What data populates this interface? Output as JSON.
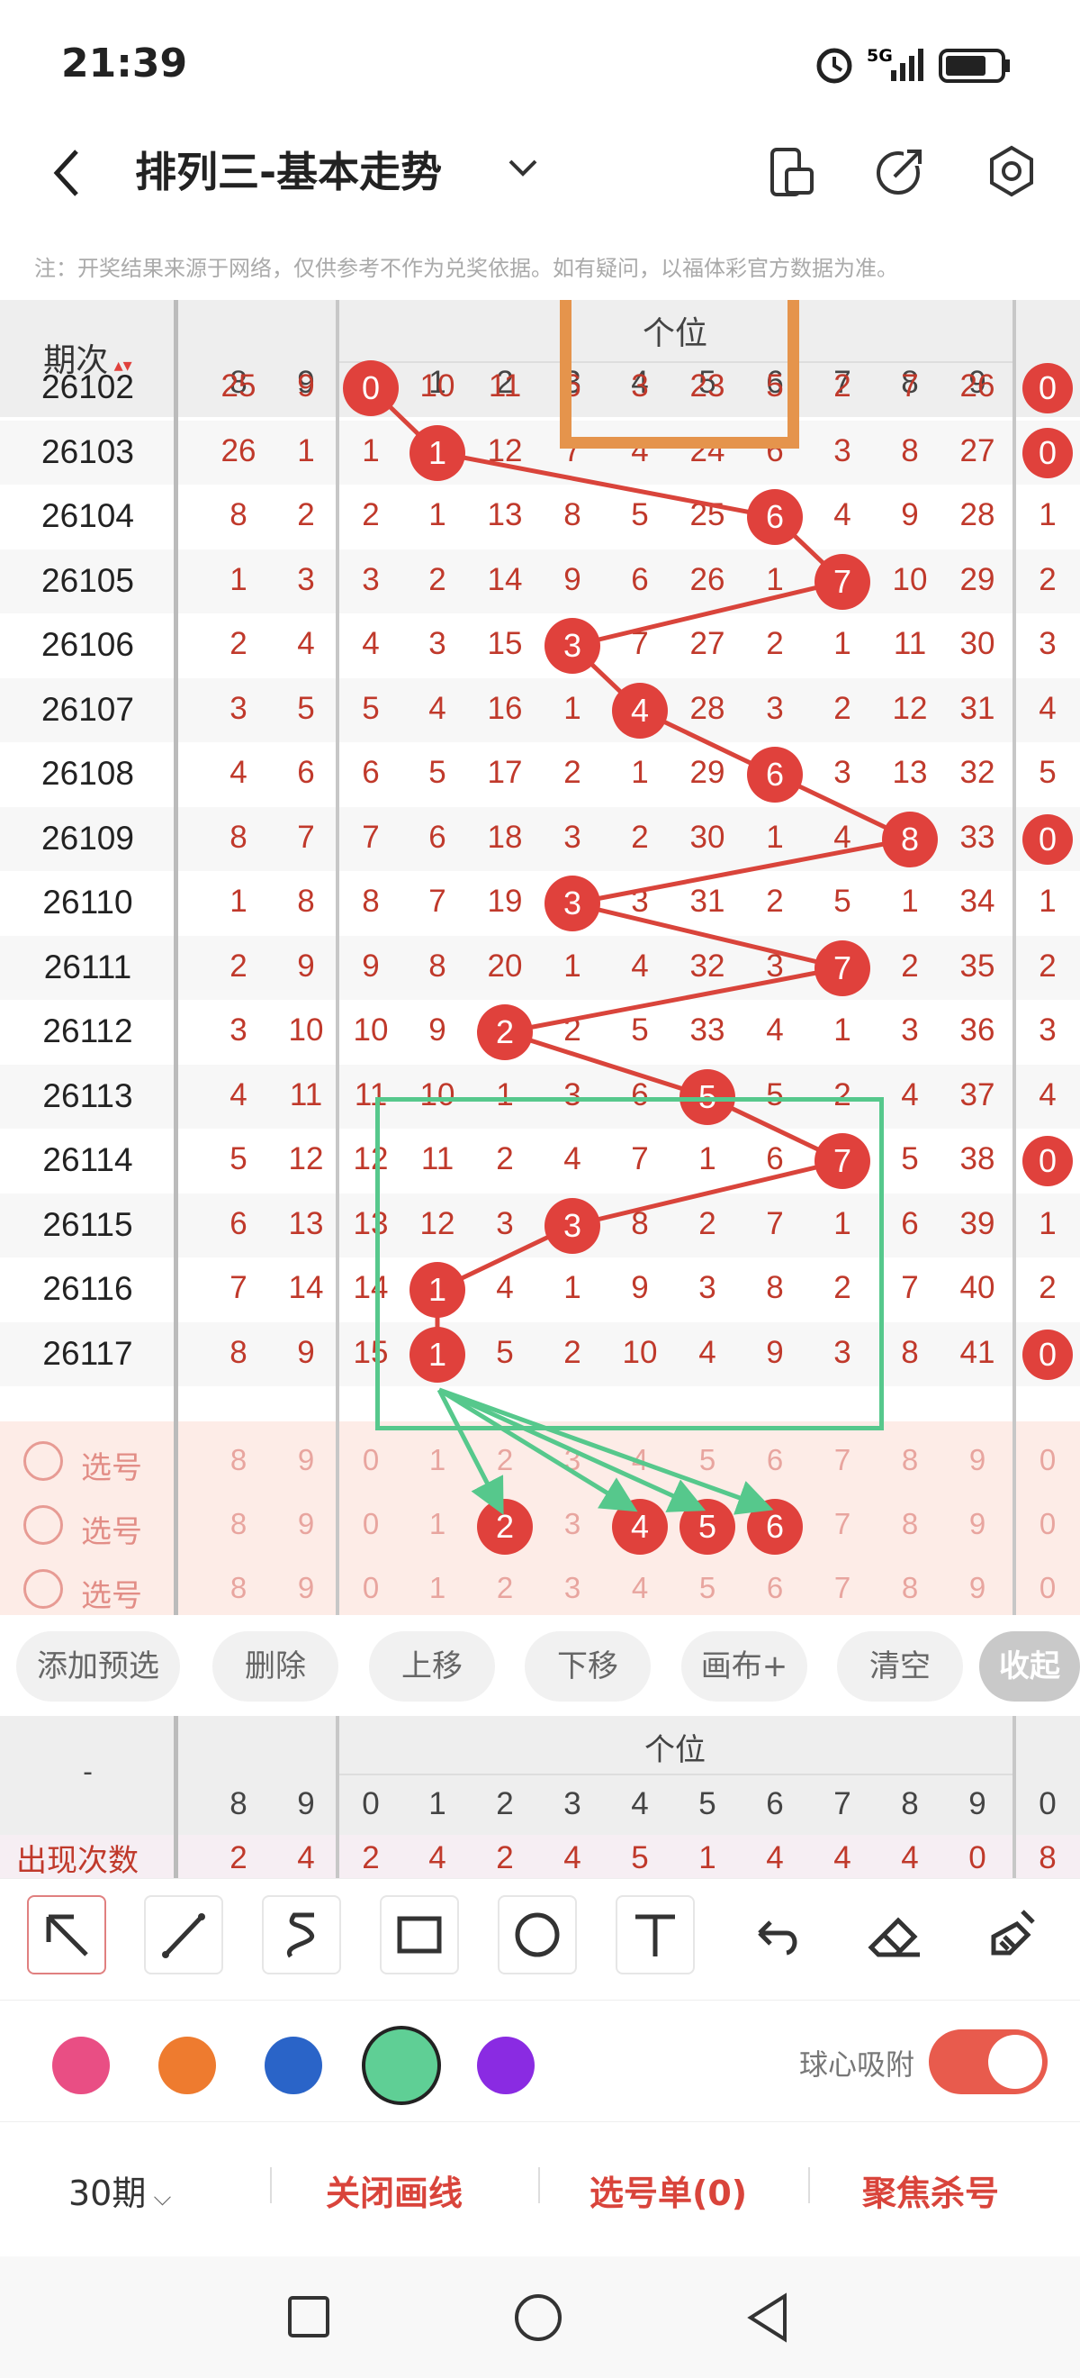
{
  "status": {
    "time": "21:39",
    "network": "5G"
  },
  "header": {
    "title": "排列三-基本走势"
  },
  "note": "注：开奖结果来源于网络，仅供参考不作为兑奖依据。如有疑问，以福体彩官方数据为准。",
  "table": {
    "period_header": "期次",
    "group_header": "个位",
    "col_digits": [
      "8",
      "9",
      "0",
      "1",
      "2",
      "3",
      "4",
      "5",
      "6",
      "7",
      "8",
      "9",
      "0"
    ],
    "rows": [
      {
        "period": "26102",
        "cells": [
          "25",
          "9",
          "0",
          "10",
          "11",
          "6",
          "3",
          "23",
          "5",
          "2",
          "7",
          "26",
          "0"
        ],
        "ball": 2
      },
      {
        "period": "26103",
        "cells": [
          "26",
          "1",
          "1",
          "1",
          "12",
          "7",
          "4",
          "24",
          "6",
          "3",
          "8",
          "27",
          "0"
        ],
        "ball": 3
      },
      {
        "period": "26104",
        "cells": [
          "8",
          "2",
          "2",
          "1",
          "13",
          "8",
          "5",
          "25",
          "6",
          "4",
          "9",
          "28",
          "1"
        ],
        "ball": 8
      },
      {
        "period": "26105",
        "cells": [
          "1",
          "3",
          "3",
          "2",
          "14",
          "9",
          "6",
          "26",
          "1",
          "7",
          "10",
          "29",
          "2"
        ],
        "ball": 9
      },
      {
        "period": "26106",
        "cells": [
          "2",
          "4",
          "4",
          "3",
          "15",
          "3",
          "7",
          "27",
          "2",
          "1",
          "11",
          "30",
          "3"
        ],
        "ball": 5
      },
      {
        "period": "26107",
        "cells": [
          "3",
          "5",
          "5",
          "4",
          "16",
          "1",
          "4",
          "28",
          "3",
          "2",
          "12",
          "31",
          "4"
        ],
        "ball": 6
      },
      {
        "period": "26108",
        "cells": [
          "4",
          "6",
          "6",
          "5",
          "17",
          "2",
          "1",
          "29",
          "6",
          "3",
          "13",
          "32",
          "5"
        ],
        "ball": 8
      },
      {
        "period": "26109",
        "cells": [
          "8",
          "7",
          "7",
          "6",
          "18",
          "3",
          "2",
          "30",
          "1",
          "4",
          "8",
          "33",
          "0"
        ],
        "ball": 10
      },
      {
        "period": "26110",
        "cells": [
          "1",
          "8",
          "8",
          "7",
          "19",
          "3",
          "3",
          "31",
          "2",
          "5",
          "1",
          "34",
          "1"
        ],
        "ball": 5
      },
      {
        "period": "26111",
        "cells": [
          "2",
          "9",
          "9",
          "8",
          "20",
          "1",
          "4",
          "32",
          "3",
          "7",
          "2",
          "35",
          "2"
        ],
        "ball": 9
      },
      {
        "period": "26112",
        "cells": [
          "3",
          "10",
          "10",
          "9",
          "2",
          "2",
          "5",
          "33",
          "4",
          "1",
          "3",
          "36",
          "3"
        ],
        "ball": 4
      },
      {
        "period": "26113",
        "cells": [
          "4",
          "11",
          "11",
          "10",
          "1",
          "3",
          "6",
          "5",
          "5",
          "2",
          "4",
          "37",
          "4"
        ],
        "ball": 7
      },
      {
        "period": "26114",
        "cells": [
          "5",
          "12",
          "12",
          "11",
          "2",
          "4",
          "7",
          "1",
          "6",
          "7",
          "5",
          "38",
          "0"
        ],
        "ball": 9
      },
      {
        "period": "26115",
        "cells": [
          "6",
          "13",
          "13",
          "12",
          "3",
          "3",
          "8",
          "2",
          "7",
          "1",
          "6",
          "39",
          "1"
        ],
        "ball": 5
      },
      {
        "period": "26116",
        "cells": [
          "7",
          "14",
          "14",
          "1",
          "4",
          "1",
          "9",
          "3",
          "8",
          "2",
          "7",
          "40",
          "2"
        ],
        "ball": 3
      },
      {
        "period": "26117",
        "cells": [
          "8",
          "9",
          "15",
          "1",
          "5",
          "2",
          "10",
          "4",
          "9",
          "3",
          "8",
          "41",
          "0"
        ],
        "ball": 3
      }
    ],
    "pick_label": "选号",
    "pick_digits": [
      "8",
      "9",
      "0",
      "1",
      "2",
      "3",
      "4",
      "5",
      "6",
      "7",
      "8",
      "9",
      "0"
    ]
  },
  "buttons": [
    "添加预选",
    "删除",
    "上移",
    "下移",
    "画布+",
    "清空",
    "收起"
  ],
  "stats": {
    "group_header": "个位",
    "dash": "-",
    "label": "出现次数",
    "digits": [
      "8",
      "9",
      "0",
      "1",
      "2",
      "3",
      "4",
      "5",
      "6",
      "7",
      "8",
      "9",
      "0"
    ],
    "counts": [
      "2",
      "4",
      "2",
      "4",
      "2",
      "4",
      "5",
      "1",
      "4",
      "4",
      "4",
      "0",
      "8"
    ]
  },
  "tools": [
    "arrow-icon",
    "line-icon",
    "curve-icon",
    "rect-icon",
    "circle-icon",
    "text-icon",
    "undo-icon",
    "eraser-icon",
    "clear-brush-icon"
  ],
  "palette": [
    "#e94e84",
    "#ee7b2f",
    "#2a64c8",
    "#5fcf95",
    "#8a2be2"
  ],
  "snap_label": "球心吸附",
  "footer": {
    "period_select": "30期",
    "close_lines": "关闭画线",
    "pick_list": "选号单(0)",
    "focus_kill": "聚焦杀号"
  }
}
